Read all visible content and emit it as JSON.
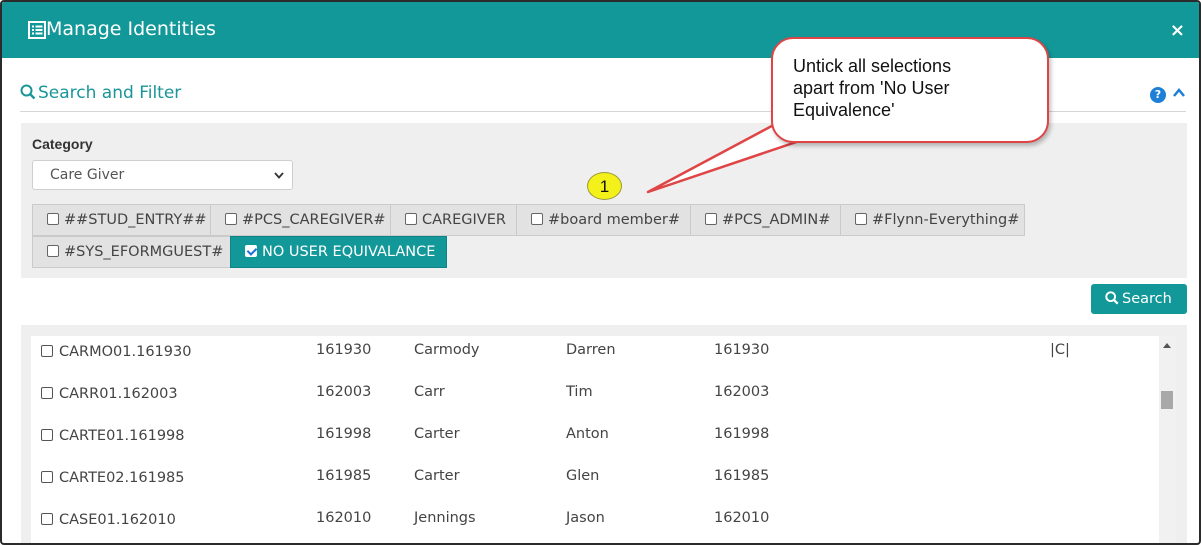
{
  "dialog": {
    "title": "Manage Identities",
    "close_label": "×"
  },
  "search_filter": {
    "heading": "Search and Filter",
    "help_label": "?"
  },
  "category": {
    "label": "Category",
    "selected": "Care Giver"
  },
  "equivalence_tags": [
    {
      "label": "##STUD_ENTRY##",
      "checked": false
    },
    {
      "label": "#PCS_CAREGIVER#",
      "checked": false
    },
    {
      "label": "CAREGIVER",
      "checked": false
    },
    {
      "label": "#board member#",
      "checked": false
    },
    {
      "label": "#PCS_ADMIN#",
      "checked": false
    },
    {
      "label": "#Flynn-Everything#",
      "checked": false
    },
    {
      "label": "#SYS_EFORMGUEST#",
      "checked": false
    },
    {
      "label": "NO USER EQUIVALANCE",
      "checked": true
    }
  ],
  "search_button": {
    "label": "Search"
  },
  "results": {
    "rows": [
      {
        "id": "CARMO01.161930",
        "number": "161930",
        "last": "Carmody",
        "first": "Darren",
        "code": "161930",
        "extra": "|C|"
      },
      {
        "id": "CARR01.162003",
        "number": "162003",
        "last": "Carr",
        "first": "Tim",
        "code": "162003",
        "extra": ""
      },
      {
        "id": "CARTE01.161998",
        "number": "161998",
        "last": "Carter",
        "first": "Anton",
        "code": "161998",
        "extra": ""
      },
      {
        "id": "CARTE02.161985",
        "number": "161985",
        "last": "Carter",
        "first": "Glen",
        "code": "161985",
        "extra": ""
      },
      {
        "id": "CASE01.162010",
        "number": "162010",
        "last": "Jennings",
        "first": "Jason",
        "code": "162010",
        "extra": ""
      }
    ]
  },
  "annotation": {
    "callout_line1": "Untick all selections",
    "callout_line2": "apart from 'No User",
    "callout_line3": "Equivalence'",
    "step_number": "1"
  },
  "colors": {
    "brand_teal": "#13989a",
    "callout_border": "#e04545",
    "step_badge": "#f3f01a"
  }
}
